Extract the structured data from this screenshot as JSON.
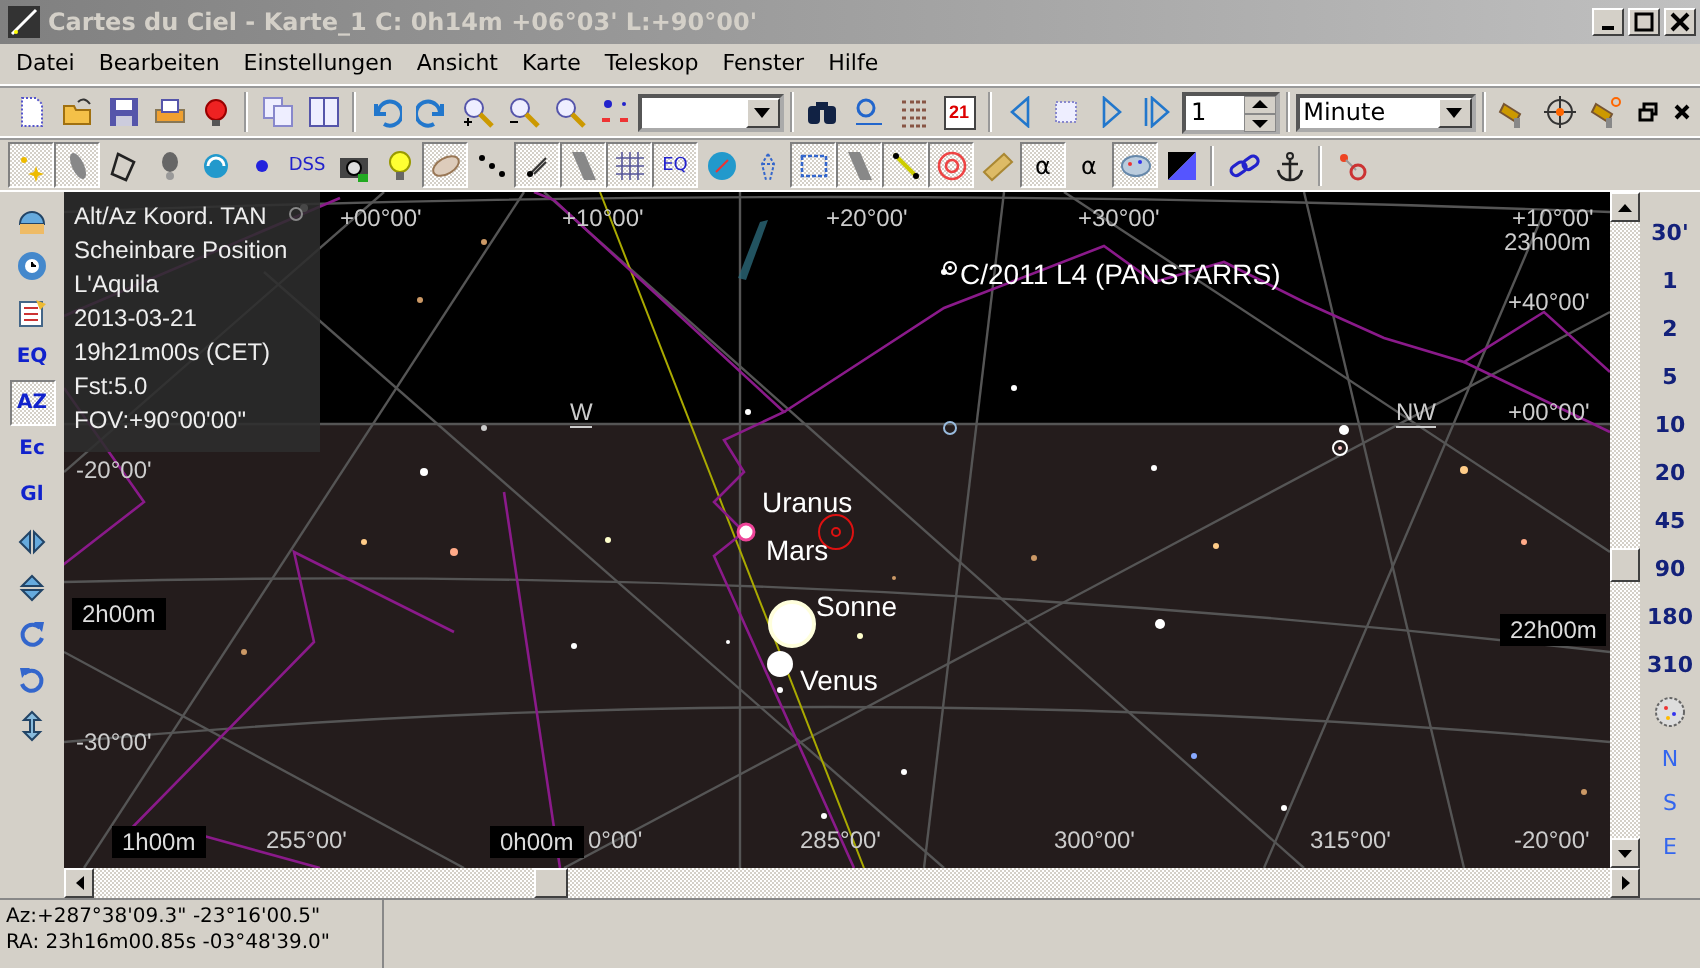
{
  "window": {
    "title": "Cartes du Ciel - Karte_1  C:  0h14m +06°03' L:+90°00'"
  },
  "menu": [
    "Datei",
    "Bearbeiten",
    "Einstellungen",
    "Ansicht",
    "Karte",
    "Teleskop",
    "Fenster",
    "Hilfe"
  ],
  "toolbar_1": {
    "calendar_day": "21",
    "time_step": "1",
    "time_unit": "Minute"
  },
  "toolbar_2": [
    {
      "pressed": true
    },
    {
      "pressed": true
    },
    {
      "pressed": false
    },
    {
      "pressed": false
    },
    {
      "pressed": false
    },
    {
      "pressed": false
    },
    {
      "label": "DSS",
      "pressed": false
    },
    {
      "pressed": false
    },
    {
      "pressed": false
    },
    {
      "pressed": true
    },
    {
      "pressed": false
    },
    {
      "pressed": true
    },
    {
      "pressed": true
    },
    {
      "pressed": true
    },
    {
      "label": "EQ",
      "pressed": true
    },
    {
      "pressed": false
    },
    {
      "pressed": false
    },
    {
      "pressed": true
    },
    {
      "pressed": true
    },
    {
      "pressed": true
    },
    {
      "pressed": true
    },
    {
      "pressed": false
    },
    {
      "label": "α",
      "pressed": true
    },
    {
      "label": "α",
      "pressed": false
    },
    {
      "pressed": true
    },
    {
      "pressed": false
    },
    {
      "pressed": false
    },
    {
      "pressed": false
    },
    {
      "pressed": false
    }
  ],
  "left_toolbar": [
    {
      "selected": false
    },
    {
      "selected": false
    },
    {
      "selected": false
    },
    {
      "label": "EQ",
      "selected": false
    },
    {
      "label": "AZ",
      "selected": true
    },
    {
      "label": "Ec",
      "selected": false
    },
    {
      "label": "Gl",
      "selected": false
    },
    {
      "selected": false
    },
    {
      "selected": false
    },
    {
      "selected": false
    },
    {
      "selected": false
    },
    {
      "selected": false
    }
  ],
  "info_panel": [
    "Alt/Az Koord. TAN",
    "Scheinbare Position",
    "L'Aquila",
    "2013-03-21",
    "19h21m00s (CET)",
    "Fst:5.0",
    "FOV:+90°00'00\""
  ],
  "map_labels": [
    {
      "text": "+00°00'",
      "kind": "grid"
    },
    {
      "text": "+10°00'",
      "kind": "grid"
    },
    {
      "text": "+20°00'",
      "kind": "grid"
    },
    {
      "text": "+30°00'",
      "kind": "grid"
    },
    {
      "text": "+10°00'",
      "kind": "grid"
    },
    {
      "text": "23h00m",
      "kind": "grid"
    },
    {
      "text": "+40°00'",
      "kind": "grid"
    },
    {
      "text": "W",
      "kind": "direction"
    },
    {
      "text": "NW",
      "kind": "direction"
    },
    {
      "text": "+00°00'",
      "kind": "grid"
    },
    {
      "text": "-20°00'",
      "kind": "grid"
    },
    {
      "text": "C/2011 L4 (PANSTARRS)",
      "kind": "object"
    },
    {
      "text": "Uranus",
      "kind": "object"
    },
    {
      "text": "Mars",
      "kind": "object"
    },
    {
      "text": "Sonne",
      "kind": "object"
    },
    {
      "text": "Venus",
      "kind": "object"
    },
    {
      "text": "2h00m",
      "kind": "boxed"
    },
    {
      "text": "22h00m",
      "kind": "boxed"
    },
    {
      "text": "-30°00'",
      "kind": "grid"
    },
    {
      "text": "1h00m",
      "kind": "boxed"
    },
    {
      "text": "255°00'",
      "kind": "grid"
    },
    {
      "text": "0h00m",
      "kind": "boxed"
    },
    {
      "text": "0°00'",
      "kind": "grid"
    },
    {
      "text": "285°00'",
      "kind": "grid"
    },
    {
      "text": "300°00'",
      "kind": "grid"
    },
    {
      "text": "315°00'",
      "kind": "grid"
    },
    {
      "text": "-20°00'",
      "kind": "grid"
    }
  ],
  "zoom_levels": [
    "30'",
    "1",
    "2",
    "5",
    "10",
    "20",
    "45",
    "90",
    "180",
    "310"
  ],
  "directions": [
    "N",
    "S",
    "E"
  ],
  "status_bar": [
    "Az:+287°38'09.3\" -23°16'00.5\"",
    "RA: 23h16m00.85s -03°48'39.0\""
  ]
}
